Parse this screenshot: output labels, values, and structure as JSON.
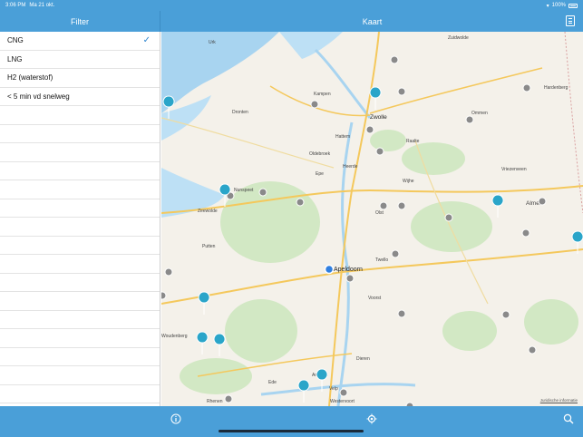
{
  "status": {
    "time": "3:06 PM",
    "date": "Ma 21 okt.",
    "battery": "100%"
  },
  "nav": {
    "filter_title": "Filter",
    "map_title": "Kaart"
  },
  "filters": [
    {
      "label": "CNG",
      "checked": true
    },
    {
      "label": "LNG",
      "checked": false
    },
    {
      "label": "H2 (waterstof)",
      "checked": false
    },
    {
      "label": "< 5 min vd snelweg",
      "checked": false
    }
  ],
  "map": {
    "legal": "Juridische informatie",
    "places": [
      {
        "name": "Urk"
      },
      {
        "name": "Kampen"
      },
      {
        "name": "Zwolle"
      },
      {
        "name": "Dronten"
      },
      {
        "name": "Hattem"
      },
      {
        "name": "Oldebroek"
      },
      {
        "name": "Heerde"
      },
      {
        "name": "Nunspeet"
      },
      {
        "name": "Zeewolde"
      },
      {
        "name": "Putten"
      },
      {
        "name": "Apeldoorn"
      },
      {
        "name": "Twello"
      },
      {
        "name": "Voorst"
      },
      {
        "name": "Almelo"
      },
      {
        "name": "Hardenberg"
      },
      {
        "name": "Ommen"
      },
      {
        "name": "Raalte"
      },
      {
        "name": "Wijhe"
      },
      {
        "name": "Olst"
      },
      {
        "name": "Vriezenveen"
      },
      {
        "name": "Woudenberg"
      },
      {
        "name": "Ede"
      },
      {
        "name": "Arnhem"
      },
      {
        "name": "Rhenen"
      },
      {
        "name": "Westervoort"
      },
      {
        "name": "Dieren"
      },
      {
        "name": "Velp"
      },
      {
        "name": "Zuidwolde"
      },
      {
        "name": "Epe"
      }
    ]
  },
  "toolbar": {
    "info": "info-icon",
    "locate": "locate-icon",
    "search": "search-icon"
  }
}
